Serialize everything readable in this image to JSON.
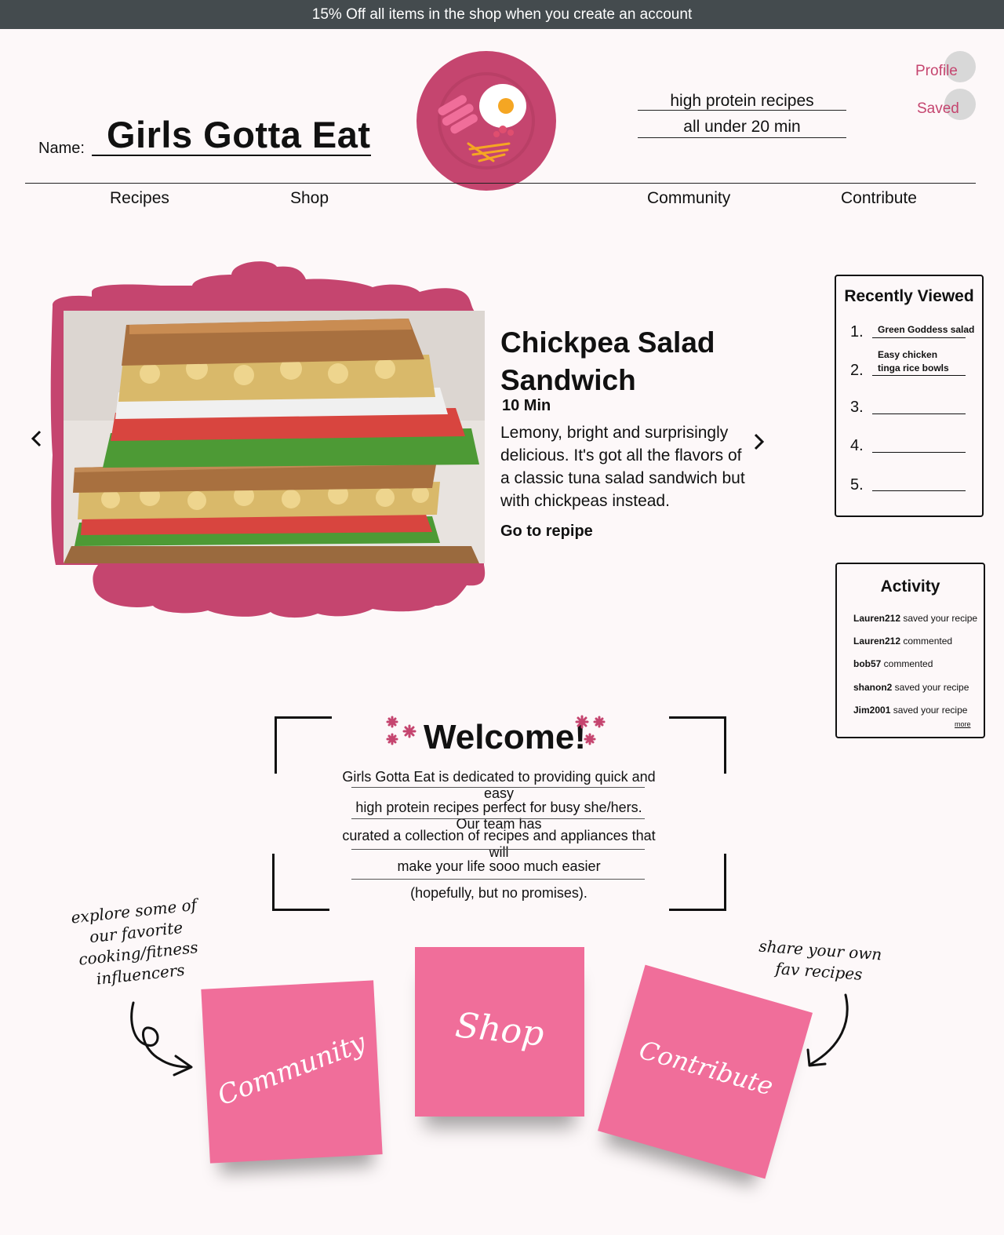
{
  "banner": {
    "text": "15% Off all items in the shop when you create an account"
  },
  "header": {
    "name_label": "Name:",
    "site_name": "Girls Gotta Eat",
    "tagline_1": "high protein recipes",
    "tagline_2": "all under 20 min",
    "profile_label": "Profile",
    "saved_label": "Saved"
  },
  "nav": {
    "items": [
      {
        "label": "Recipes"
      },
      {
        "label": "Shop"
      },
      {
        "label": "Community"
      },
      {
        "label": "Contribute"
      }
    ]
  },
  "hero": {
    "title_1": "Chickpea Salad",
    "title_2": "Sandwich",
    "time": "10 Min",
    "description": "Lemony, bright and surprisingly delicious. It's got all the flavors of a classic tuna salad sandwich but with chickpeas instead.",
    "link": "Go to repipe",
    "prev_icon": "chevron-left-icon",
    "next_icon": "chevron-right-icon"
  },
  "recently_viewed": {
    "title": "Recently Viewed",
    "items": [
      {
        "num": "1.",
        "label": "Green Goddess salad"
      },
      {
        "num": "2.",
        "label": "Easy chicken tinga rice bowls"
      },
      {
        "num": "3.",
        "label": ""
      },
      {
        "num": "4.",
        "label": ""
      },
      {
        "num": "5.",
        "label": ""
      }
    ]
  },
  "activity": {
    "title": "Activity",
    "rows": [
      {
        "user": "Lauren212",
        "action": " saved your recipe"
      },
      {
        "user": "Lauren212",
        "action": " commented"
      },
      {
        "user": "bob57",
        "action": " commented"
      },
      {
        "user": "shanon2",
        "action": " saved your recipe"
      },
      {
        "user": "Jim2001",
        "action": " saved your recipe"
      }
    ],
    "more": "more"
  },
  "welcome": {
    "title": "Welcome!",
    "lines": [
      "Girls Gotta Eat is dedicated to providing quick and easy",
      "high protein recipes perfect for busy she/hers. Our team has",
      "curated a collection of recipes and appliances that will",
      "make your life sooo much easier",
      "(hopefully,  but no promises)."
    ]
  },
  "notes": {
    "left_caption": [
      "explore some of",
      "our favorite",
      "cooking/fitness",
      "influencers"
    ],
    "right_caption": [
      "share your own",
      "fav recipes"
    ],
    "community": "Community",
    "shop": "Shop",
    "contribute": "Contribute"
  },
  "colors": {
    "brand": "#c5456f",
    "note": "#f06e9a",
    "banner": "#444b4e"
  }
}
